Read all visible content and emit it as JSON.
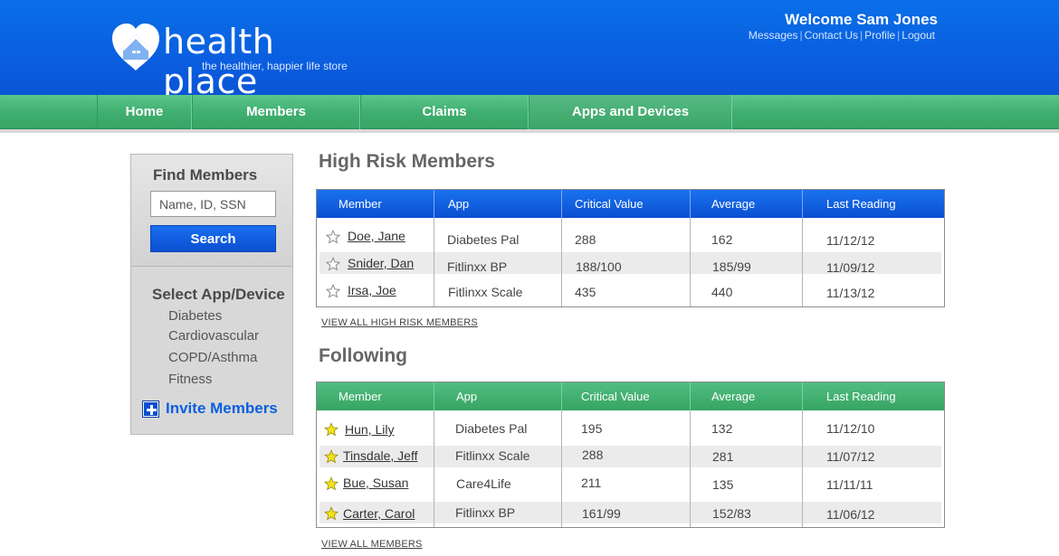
{
  "app": {
    "name": "health place",
    "tagline": "the healthier, happier life store"
  },
  "header": {
    "welcome": "Welcome Sam Jones",
    "links": [
      "Messages",
      "Contact Us",
      "Profile",
      "Logout"
    ]
  },
  "nav": {
    "items": [
      "Home",
      "Members",
      "Claims",
      "Apps and Devices"
    ],
    "active": "Apps and Devices"
  },
  "sidebar": {
    "find_title": "Find Members",
    "search_placeholder": "Name, ID, SSN",
    "search_button": "Search",
    "select_title": "Select App/Device",
    "devices": [
      "Diabetes",
      "Cardiovascular",
      "COPD/Asthma",
      "Fitness"
    ],
    "invite_label": "Invite Members"
  },
  "high_risk": {
    "title": "High Risk Members",
    "columns": [
      "Member",
      "App",
      "Critical Value",
      "Average",
      "Last Reading"
    ],
    "rows": [
      {
        "member": "Doe, Jane",
        "app": "Diabetes Pal",
        "critical": "288",
        "average": "162",
        "last": "11/12/12",
        "starred": false
      },
      {
        "member": "Snider, Dan",
        "app": "Fitlinxx BP",
        "critical": "188/100",
        "average": "185/99",
        "last": "11/09/12",
        "starred": false
      },
      {
        "member": "Irsa, Joe",
        "app": "Fitlinxx Scale",
        "critical": "435",
        "average": "440",
        "last": "11/13/12",
        "starred": false
      }
    ],
    "view_all": "VIEW ALL HIGH RISK MEMBERS"
  },
  "following": {
    "title": "Following",
    "columns": [
      "Member",
      "App",
      "Critical Value",
      "Average",
      "Last Reading"
    ],
    "rows": [
      {
        "member": "Hun, Lily",
        "app": "Diabetes Pal",
        "critical": "195",
        "average": "132",
        "last": "11/12/10",
        "starred": true
      },
      {
        "member": "Tinsdale, Jeff",
        "app": "Fitlinxx Scale",
        "critical": "288",
        "average": "281",
        "last": "11/07/12",
        "starred": true
      },
      {
        "member": "Bue, Susan",
        "app": "Care4Life",
        "critical": "211",
        "average": "135",
        "last": "11/11/11",
        "starred": true
      },
      {
        "member": "Carter, Carol",
        "app": "Fitlinxx BP",
        "critical": "161/99",
        "average": "152/83",
        "last": "11/06/12",
        "starred": true
      }
    ],
    "view_all": "VIEW ALL MEMBERS"
  },
  "colors": {
    "header_blue": "#0a5fe0",
    "nav_green": "#3fae6f",
    "star_yellow": "#f2e21c"
  },
  "icons": {
    "empty_star": "star-outline-icon",
    "filled_star": "star-filled-icon",
    "invite": "plus-icon",
    "logo": "heart-house-icon"
  }
}
